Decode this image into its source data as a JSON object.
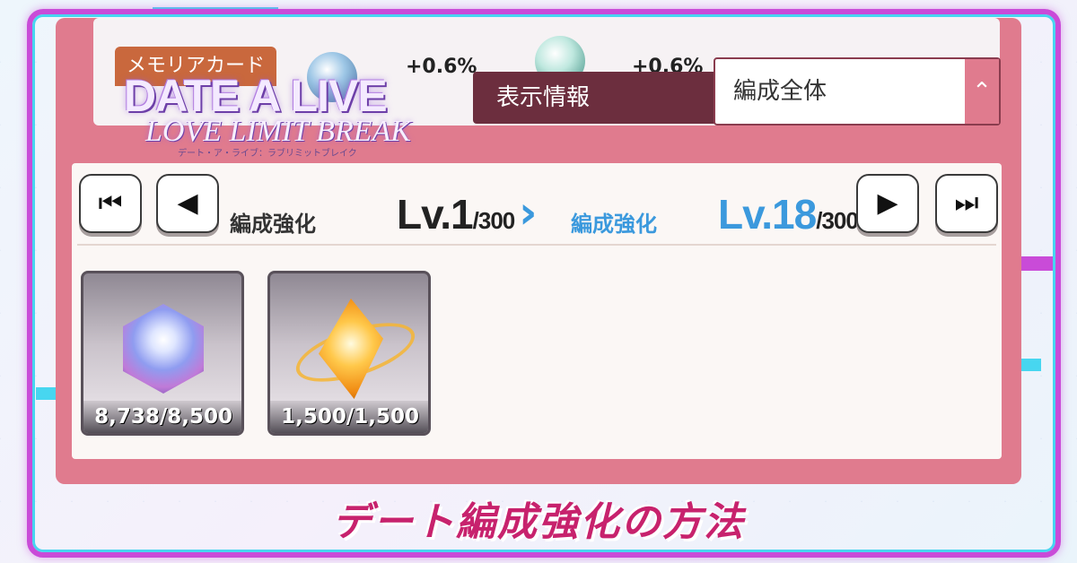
{
  "logo": {
    "main": "DATE A LIVE",
    "sub": "LOVE LIMIT BREAK",
    "kana": "デート・ア・ライブ：ラブリミットブレイク"
  },
  "top_strip": {
    "memory_card_tab": "メモリアカード",
    "stats": [
      "+0.6%",
      "+0.6%"
    ]
  },
  "display_info": {
    "label": "表示情報",
    "selected": "編成全体",
    "arrow_glyph": "⌃"
  },
  "nav": {
    "first": "⏮",
    "prev": "◀",
    "next": "▶",
    "last": "⏭"
  },
  "enhance": {
    "current": {
      "label": "編成強化",
      "level": "Lv.1",
      "max": "/300"
    },
    "arrow": "›",
    "target": {
      "label": "編成強化",
      "level": "Lv.18",
      "max": "/300"
    }
  },
  "items": [
    {
      "name": "cube-material",
      "count": "8,738/8,500"
    },
    {
      "name": "crystal-material",
      "count": "1,500/1,500"
    }
  ],
  "banner": {
    "title": "デート編成強化の方法"
  },
  "colors": {
    "panel": "#e07b8e",
    "label_bg": "#6c2e3e",
    "target_blue": "#3b99dd",
    "banner_text": "#c7226d",
    "neon_purple": "#c94bd8",
    "neon_cyan": "#47d6f0"
  }
}
